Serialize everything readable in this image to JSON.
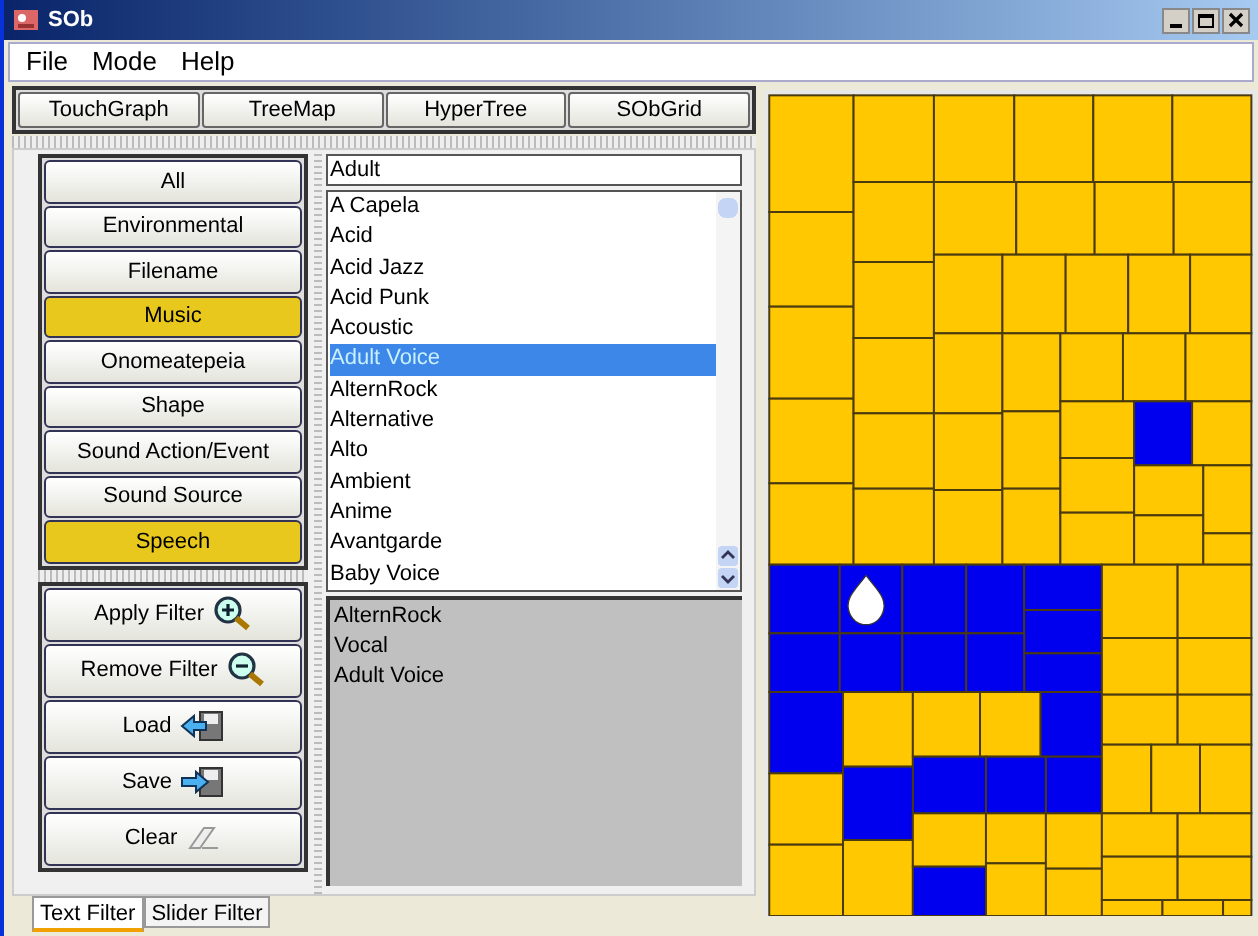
{
  "window": {
    "title": "SOb"
  },
  "menu": [
    "File",
    "Mode",
    "Help"
  ],
  "views": [
    "TouchGraph",
    "TreeMap",
    "HyperTree",
    "SObGrid"
  ],
  "categories": [
    {
      "label": "All",
      "selected": false
    },
    {
      "label": "Environmental",
      "selected": false
    },
    {
      "label": "Filename",
      "selected": false
    },
    {
      "label": "Music",
      "selected": true
    },
    {
      "label": "Onomeatepeia",
      "selected": false
    },
    {
      "label": "Shape",
      "selected": false
    },
    {
      "label": "Sound Action/Event",
      "selected": false
    },
    {
      "label": "Sound Source",
      "selected": false
    },
    {
      "label": "Speech",
      "selected": true
    }
  ],
  "filter_field": {
    "value": "Adult"
  },
  "terms": [
    {
      "label": "A Capela",
      "selected": false
    },
    {
      "label": "Acid",
      "selected": false
    },
    {
      "label": "Acid Jazz",
      "selected": false
    },
    {
      "label": "Acid Punk",
      "selected": false
    },
    {
      "label": "Acoustic",
      "selected": false
    },
    {
      "label": "Adult Voice",
      "selected": true
    },
    {
      "label": "AlternRock",
      "selected": false
    },
    {
      "label": "Alternative",
      "selected": false
    },
    {
      "label": "Alto",
      "selected": false
    },
    {
      "label": "Ambient",
      "selected": false
    },
    {
      "label": "Anime",
      "selected": false
    },
    {
      "label": "Avantgarde",
      "selected": false
    },
    {
      "label": "Baby Voice",
      "selected": false
    }
  ],
  "applied_filters": [
    "AlternRock",
    "Vocal",
    "Adult Voice"
  ],
  "actions": [
    {
      "label": "Apply Filter",
      "kind": "zoom-in"
    },
    {
      "label": "Remove Filter",
      "kind": "zoom-out"
    },
    {
      "label": "Load",
      "kind": "load"
    },
    {
      "label": "Save",
      "kind": "save"
    },
    {
      "label": "Clear",
      "kind": "clear"
    }
  ],
  "tabs": [
    {
      "label": "Text Filter",
      "selected": true
    },
    {
      "label": "Slider Filter",
      "selected": false
    }
  ]
}
